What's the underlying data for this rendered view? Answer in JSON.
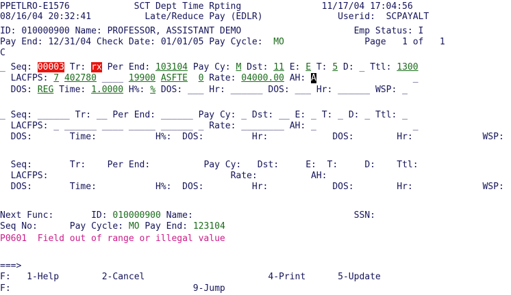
{
  "header": {
    "program": "PPETLRO-E1576",
    "system_title": "SCT Dept Time Rpting",
    "current_date": "11/17/04",
    "current_time": "17:04:56",
    "run_date": "08/16/04",
    "run_time": "20:32:41",
    "screen_title": "Late/Reduce Pay (EDLR)",
    "userid_label": "Userid:",
    "userid": "SCPAYALT",
    "id_label": "ID:",
    "id": "010000900",
    "name_label": "Name:",
    "name": "PROFESSOR, ASSISTANT DEMO",
    "emp_status_label": "Emp Status:",
    "emp_status": "I",
    "pay_end_label": "Pay End:",
    "pay_end": "12/31/04",
    "check_date_label": "Check Date:",
    "check_date": "01/01/05",
    "pay_cycle_label": "Pay Cycle:",
    "pay_cycle": "MO",
    "page_label": "Page",
    "page_num": "1",
    "of_label": "of",
    "page_total": "1",
    "c_flag": "C"
  },
  "labels": {
    "seq": "Seq:",
    "tr": "Tr:",
    "per_end": "Per End:",
    "pay_cy": "Pay Cy:",
    "dst": "Dst:",
    "e": "E:",
    "t": "T:",
    "d": "D:",
    "ttl": "Ttl:",
    "lacfps": "LACFPS:",
    "rate": "Rate:",
    "ah": "AH:",
    "dos": "DOS:",
    "time": "Time:",
    "hpct": "H%:",
    "hr": "Hr:",
    "wsp": "WSP:"
  },
  "entries": [
    {
      "sel": "_",
      "seq": "00003",
      "tr": "rx",
      "per_end": "103104",
      "pay_cy": "M",
      "dst": "11",
      "e": "E",
      "t": "5",
      "d": "_",
      "ttl": "1300",
      "lac": "7",
      "fund": "402780",
      "f3": "____",
      "f4": "19900",
      "f5": "ASFTE",
      "f6": "0",
      "rate": "04000.00",
      "ah": "A",
      "tail": "_",
      "dos": "REG",
      "time": "1.0000",
      "hpct": "%",
      "dos2": "___",
      "hr": "______",
      "dos3": "___",
      "hr2": "______",
      "wsp": "_"
    },
    {
      "sel": "_",
      "seq": "______",
      "tr": "__",
      "per_end": "______",
      "pay_cy": "_",
      "dst": "__",
      "e": "_",
      "t": "_",
      "d": "_",
      "ttl": "_",
      "lac": "_",
      "fund": "______",
      "f3": "____",
      "f4": "_____",
      "f5": "______",
      "f6": "_",
      "rate": "________",
      "ah": "_",
      "tail": "_"
    }
  ],
  "footer": {
    "next_func_label": "Next Func:",
    "id_label": "ID:",
    "id": "010000900",
    "name_label": "Name:",
    "ssn_label": "SSN:",
    "seq_no_label": "Seq No:",
    "pay_cycle_label": "Pay Cycle:",
    "pay_cycle": "MO",
    "pay_end_label": "Pay End:",
    "pay_end": "123104",
    "message": "P0601  Field out of range or illegal value",
    "command_prompt": "===>",
    "f_label": "F:",
    "keys": {
      "help": "1-Help",
      "cancel": "2-Cancel",
      "print": "4-Print",
      "update": "5-Update",
      "jump": "9-Jump"
    }
  }
}
